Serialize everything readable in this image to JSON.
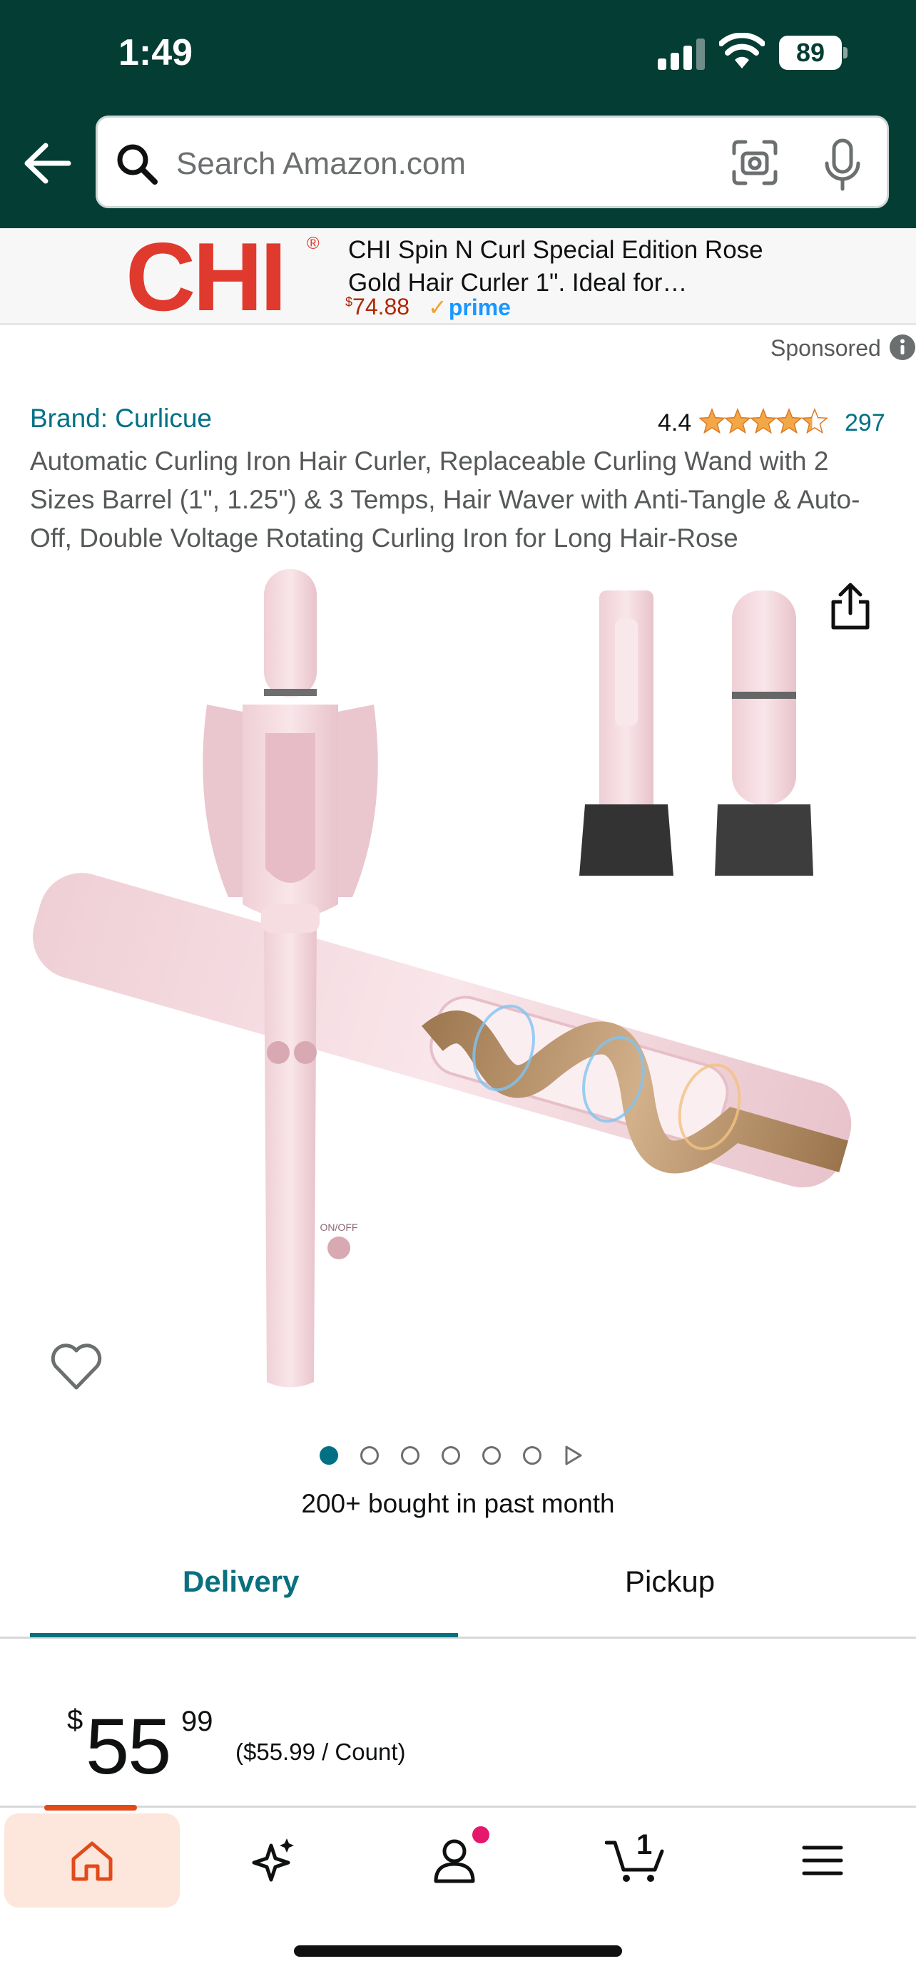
{
  "status_bar": {
    "time": "1:49",
    "battery": "89"
  },
  "search": {
    "placeholder": "Search Amazon.com"
  },
  "ad": {
    "logo_text": "CHI",
    "reg_mark": "®",
    "title": "CHI Spin N Curl Special Edition Rose Gold Hair Curler 1\". Ideal for…",
    "price_symbol": "$",
    "price": "74.88",
    "prime_label": "prime"
  },
  "sponsored_label": "Sponsored",
  "product": {
    "brand": "Brand: Curlicue",
    "rating": "4.4",
    "rating_stars": 4.4,
    "rating_count": "297",
    "title": "Automatic Curling Iron Hair Curler, Replaceable Curling Wand with 2 Sizes Barrel (1\", 1.25\") & 3 Temps, Hair Waver with Anti-Tangle & Auto-Off, Double Voltage Rotating Curling Iron for Long Hair-Rose",
    "image_labels": {
      "on_off": "ON/OFF"
    },
    "image_count": 6,
    "active_image": 1,
    "bought": "200+ bought in past month"
  },
  "tabs": [
    {
      "label": "Delivery",
      "active": true
    },
    {
      "label": "Pickup",
      "active": false
    }
  ],
  "price": {
    "symbol": "$",
    "whole": "55",
    "fraction": "99",
    "per_unit": "($55.99 / Count)"
  },
  "bottom_nav": {
    "items": [
      "home-icon",
      "sparkle-icon",
      "account-icon",
      "cart-icon",
      "menu-icon"
    ],
    "cart_count": "1"
  },
  "colors": {
    "header": "#033d34",
    "link": "#007185",
    "tab_active": "#08707f",
    "price_red": "#b12704",
    "star": "#f3a847",
    "chi_red": "#e03a2e"
  }
}
